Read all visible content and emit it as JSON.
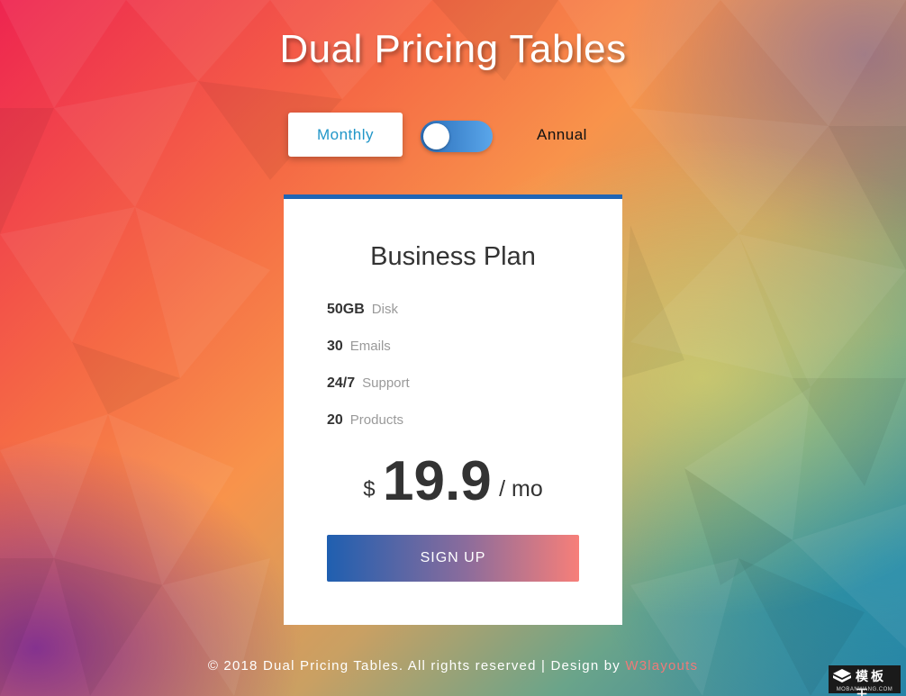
{
  "header": {
    "title": "Dual Pricing Tables"
  },
  "billing_toggle": {
    "monthly_label": "Monthly",
    "annual_label": "Annual",
    "selected": "Monthly"
  },
  "plan": {
    "name": "Business Plan",
    "features": [
      {
        "value": "50GB",
        "label": "Disk"
      },
      {
        "value": "30",
        "label": "Emails"
      },
      {
        "value": "24/7",
        "label": "Support"
      },
      {
        "value": "20",
        "label": "Products"
      }
    ],
    "price": {
      "currency": "$",
      "amount": "19.9",
      "period": "/ mo"
    },
    "signup_label": "SIGN UP"
  },
  "footer": {
    "text": "© 2018 Dual Pricing Tables. All rights reserved | Design by ",
    "link_label": "W3layouts"
  },
  "watermark": {
    "text": "模板王",
    "sub": "MOBANWANG.COM"
  },
  "colors": {
    "accent": "#2196c8",
    "card_top_border": "#1f65b5",
    "signup_gradient_start": "#1f5fb0",
    "signup_gradient_end": "#f77f79",
    "footer_link": "#f07a78"
  }
}
